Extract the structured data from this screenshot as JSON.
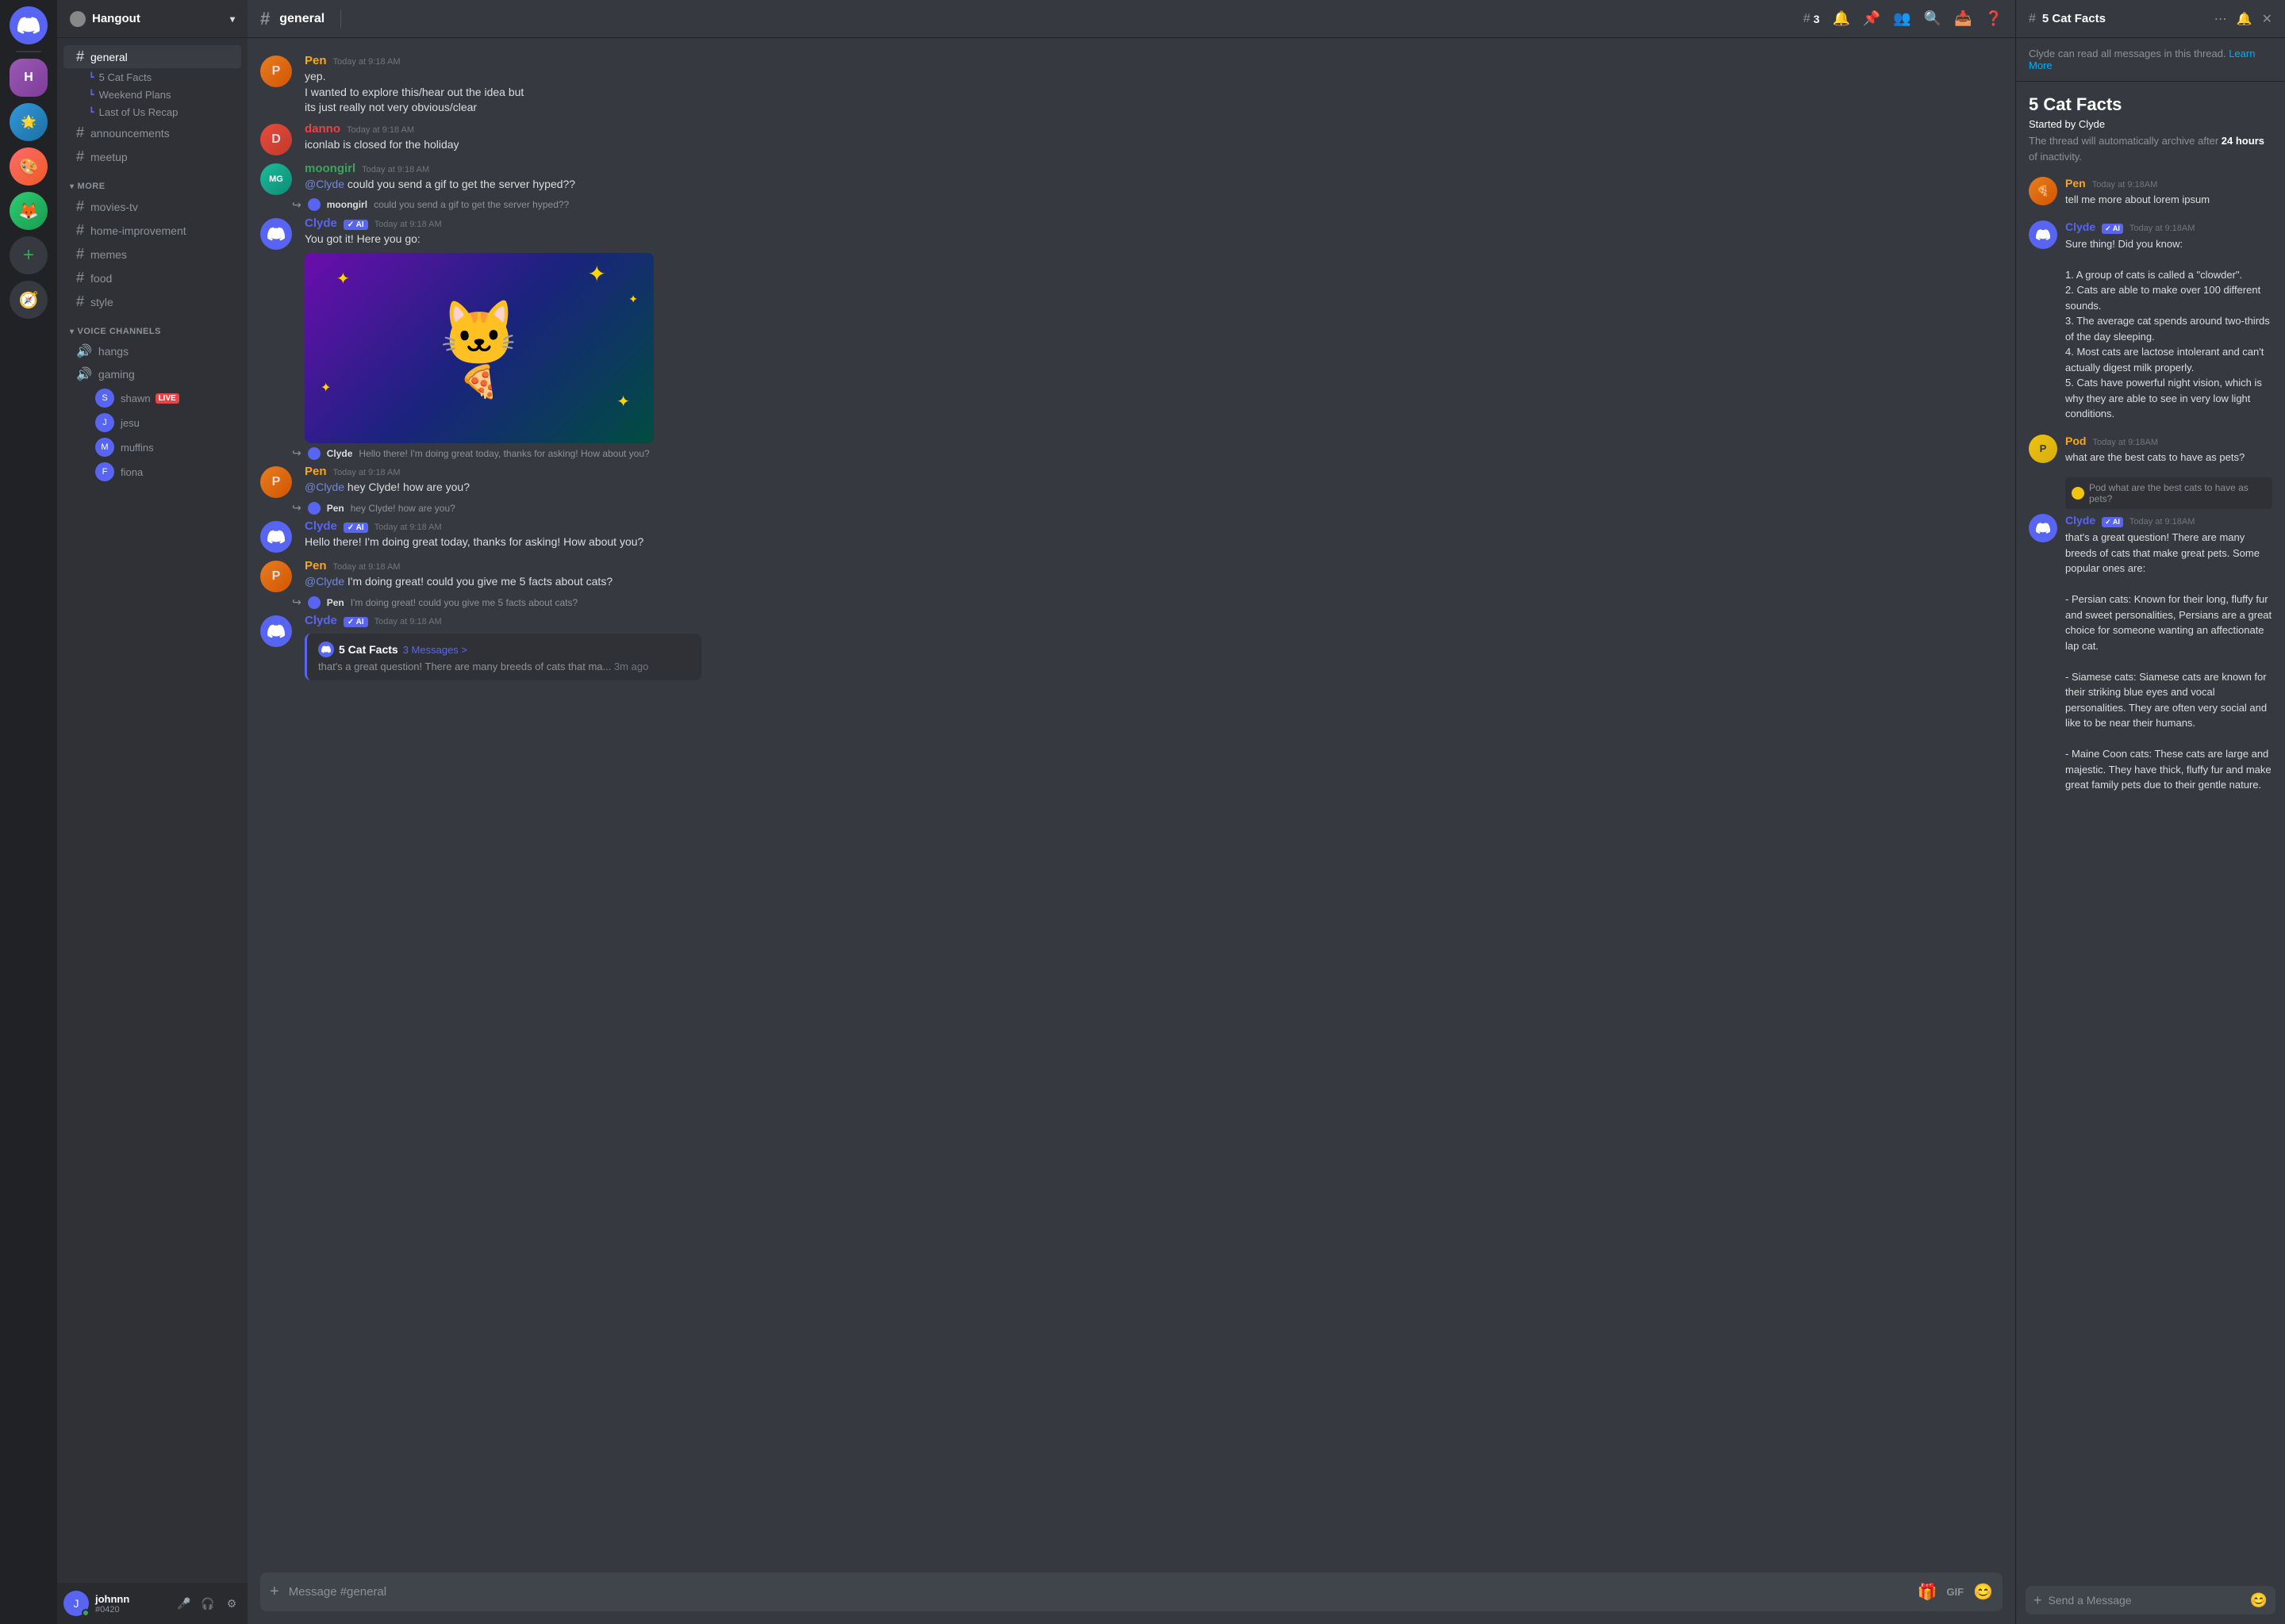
{
  "app": {
    "title": "Discord",
    "servers": [
      {
        "id": "discord",
        "label": "Discord Home",
        "icon": "🎮",
        "class": "discord"
      },
      {
        "id": "hangout",
        "label": "Hangout",
        "icon": "H"
      },
      {
        "id": "s1",
        "label": "Server 1",
        "icon": "🌟"
      },
      {
        "id": "s2",
        "label": "Server 2",
        "icon": "🎨"
      },
      {
        "id": "s3",
        "label": "Server 3",
        "icon": "🦊"
      },
      {
        "id": "add",
        "label": "Add Server",
        "icon": "+"
      },
      {
        "id": "explore",
        "label": "Explore",
        "icon": "🧭"
      }
    ]
  },
  "sidebar": {
    "server_name": "Hangout",
    "channels": [
      {
        "id": "general",
        "name": "general",
        "type": "text",
        "active": true
      },
      {
        "id": "cat-facts",
        "name": "5 Cat Facts",
        "type": "thread"
      },
      {
        "id": "weekend",
        "name": "Weekend Plans",
        "type": "thread"
      },
      {
        "id": "last-of-us",
        "name": "Last of Us Recap",
        "type": "thread"
      },
      {
        "id": "announcements",
        "name": "announcements",
        "type": "text"
      },
      {
        "id": "meetup",
        "name": "meetup",
        "type": "text"
      }
    ],
    "more_category": "MORE",
    "more_channels": [
      {
        "id": "movies-tv",
        "name": "movies-tv",
        "type": "text"
      },
      {
        "id": "home-improvement",
        "name": "home-improvement",
        "type": "text"
      },
      {
        "id": "memes",
        "name": "memes",
        "type": "text"
      },
      {
        "id": "food",
        "name": "food",
        "type": "text"
      },
      {
        "id": "style",
        "name": "style",
        "type": "text"
      }
    ],
    "voice_category": "VOICE CHANNELS",
    "voice_channels": [
      {
        "id": "hangs",
        "name": "hangs"
      },
      {
        "id": "gaming",
        "name": "gaming"
      }
    ],
    "voice_users": [
      {
        "id": "shawn",
        "name": "shawn",
        "live": true,
        "color": "av-red"
      },
      {
        "id": "jesu",
        "name": "jesu",
        "live": false,
        "color": "av-blue"
      },
      {
        "id": "muffins",
        "name": "muffins",
        "live": false,
        "color": "av-purple"
      },
      {
        "id": "fiona",
        "name": "fiona",
        "live": false,
        "color": "av-green"
      }
    ],
    "user": {
      "name": "johnnn",
      "tag": "#0420",
      "status": "online",
      "color": "av-teal"
    }
  },
  "header": {
    "channel_name": "general",
    "thread_count": "3",
    "learn_more": "Learn More"
  },
  "messages": [
    {
      "id": "m1",
      "author": "Pen",
      "author_color": "author-pen",
      "avatar_color": "av-orange",
      "avatar_text": "P",
      "timestamp": "Today at 9:18 AM",
      "lines": [
        "yep.",
        "I wanted to explore this/hear out the idea but",
        "its just really not very obvious/clear"
      ],
      "type": "normal"
    },
    {
      "id": "m2",
      "author": "danno",
      "author_color": "author-danno",
      "avatar_color": "av-red",
      "avatar_text": "D",
      "timestamp": "Today at 9:18 AM",
      "lines": [
        "iconlab is closed for the holiday"
      ],
      "type": "normal"
    },
    {
      "id": "m3",
      "author": "moongirl",
      "author_color": "author-moongirl",
      "avatar_color": "av-teal",
      "avatar_text": "MG",
      "timestamp": "Today at 9:18 AM",
      "lines": [
        "@Clyde could you send a gif to get the server hyped??"
      ],
      "type": "normal"
    },
    {
      "id": "m4-reply",
      "reply_author": "moongirl",
      "reply_text": "could you send a gif to get the server hyped??",
      "reply_avatar_color": "av-teal",
      "author": "Clyde",
      "author_color": "author-clyde",
      "avatar_color": "av-clyde",
      "avatar_text": "C",
      "is_ai": true,
      "timestamp": "Today at 9:18 AM",
      "lines": [
        "You got it! Here you go:"
      ],
      "has_image": true,
      "type": "reply"
    },
    {
      "id": "m5",
      "author": "Pen",
      "author_color": "author-pen",
      "avatar_color": "av-orange",
      "avatar_text": "P",
      "timestamp": "Today at 9:18 AM",
      "reply_context": "Clyde",
      "reply_text_ctx": "Hello there! I'm doing great today, thanks for asking! How about you?",
      "reply_avatar_color": "av-clyde",
      "lines": [
        "@Clyde hey Clyde! how are you?"
      ],
      "type": "normal"
    },
    {
      "id": "m6-reply",
      "reply_author": "Pen",
      "reply_text": "hey Clyde! how are you?",
      "reply_avatar_color": "av-orange",
      "author": "Clyde",
      "author_color": "author-clyde",
      "avatar_color": "av-clyde",
      "avatar_text": "C",
      "is_ai": true,
      "timestamp": "Today at 9:18 AM",
      "lines": [
        "Hello there! I'm doing great today, thanks for asking! How about you?"
      ],
      "type": "reply"
    },
    {
      "id": "m7",
      "author": "Pen",
      "author_color": "author-pen",
      "avatar_color": "av-orange",
      "avatar_text": "P",
      "timestamp": "Today at 9:18 AM",
      "lines": [
        "@Clyde I'm doing great! could you give me 5 facts about cats?"
      ],
      "type": "normal"
    },
    {
      "id": "m8-reply",
      "reply_author": "Pen",
      "reply_text": "I'm doing great! could you give me 5 facts about cats?",
      "reply_avatar_color": "av-orange",
      "author": "Clyde",
      "author_color": "author-clyde",
      "avatar_color": "av-clyde",
      "avatar_text": "C",
      "is_ai": true,
      "timestamp": "Today at 9:18 AM",
      "has_thread": true,
      "thread_title": "5 Cat Facts",
      "thread_messages": "3 Messages",
      "thread_preview": "that's a great question! There are many breeds of cats that ma...",
      "thread_time": "3m ago",
      "type": "reply"
    }
  ],
  "message_input": {
    "placeholder": "Message #general"
  },
  "thread_panel": {
    "title": "5 Cat Facts",
    "clyde_banner": "Clyde can read all messages in this thread.",
    "learn_more": "Learn More",
    "thread_title": "5 Cat Facts",
    "started_by": "Started by",
    "started_user": "Clyde",
    "archive_note": "The thread will automatically archive after",
    "archive_hours": "24 hours",
    "archive_suffix": "of inactivity.",
    "messages": [
      {
        "id": "t1",
        "author": "Pen",
        "author_color": "author-pen",
        "avatar_color": "av-orange",
        "avatar_text": "P",
        "timestamp": "Today at 9:18AM",
        "text": "tell me more about lorem ipsum",
        "type": "normal"
      },
      {
        "id": "t2",
        "author": "Clyde",
        "author_color": "author-clyde",
        "avatar_color": "av-clyde",
        "avatar_text": "C",
        "is_ai": true,
        "timestamp": "Today at 9:18AM",
        "text": "Sure thing! Did you know:\n\n1. A group of cats is called a \"clowder\".\n2. Cats are able to make over 100 different sounds.\n3. The average cat spends around two-thirds of the day sleeping.\n4. Most cats are lactose intolerant and can't actually digest milk properly.\n5. Cats have powerful night vision, which is why they are able to see in very low light conditions.",
        "type": "normal"
      },
      {
        "id": "t3",
        "author": "Pod",
        "author_color": "author-pod",
        "avatar_color": "av-yellow",
        "avatar_text": "P",
        "timestamp": "Today at 9:18AM",
        "text": "what are the best cats to have as pets?",
        "type": "normal"
      },
      {
        "id": "t4-reply",
        "reply_author": "Pod",
        "reply_text": "what are the best cats to have as pets?",
        "reply_avatar_color": "av-yellow",
        "author": "Clyde",
        "author_color": "author-clyde",
        "avatar_color": "av-clyde",
        "avatar_text": "C",
        "is_ai": true,
        "timestamp": "Today at 9:18AM",
        "text": "that's a great question! There are many breeds of cats that make great pets. Some popular ones are:\n\n- Persian cats: Known for their long, fluffy fur and sweet personalities, Persians are a great choice for someone wanting an affectionate lap cat.\n\n- Siamese cats: Siamese cats are known for their striking blue eyes and vocal personalities. They are often very social and like to be near their humans.\n\n- Maine Coon cats: These cats are large and majestic. They have thick, fluffy fur and make great family pets due to their gentle nature.",
        "type": "reply"
      }
    ],
    "input_placeholder": "Send a Message"
  }
}
